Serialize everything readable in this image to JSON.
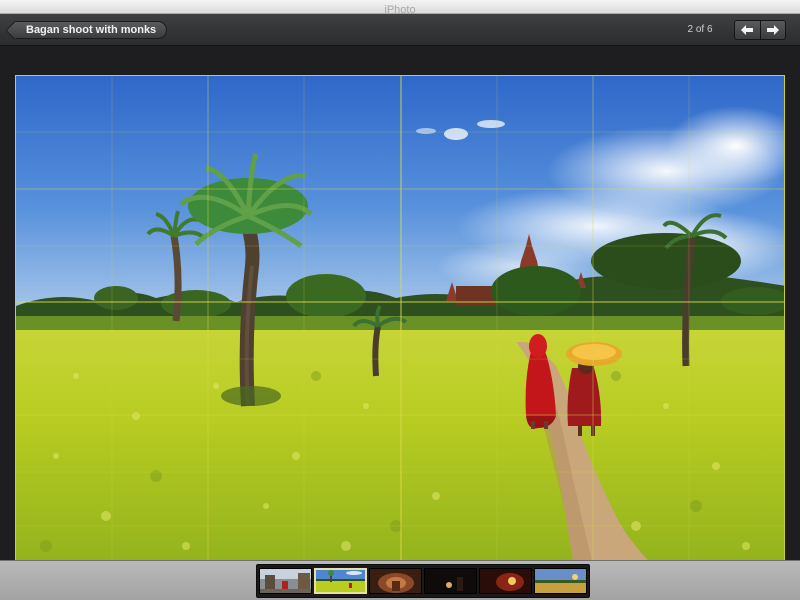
{
  "window": {
    "title": "iPhoto"
  },
  "toolbar": {
    "album_button_label": "Bagan shoot with monks",
    "page_counter": "2 of 6",
    "prev_icon": "left-arrow-icon",
    "next_icon": "right-arrow-icon"
  },
  "viewer": {
    "grid_color": "#d9d94a",
    "border_color": "#c9cf3a",
    "photo_index": 2,
    "photo_count": 6
  },
  "filmstrip": {
    "selected_index": 1,
    "thumbnails": [
      {
        "name": "thumb-street-scene"
      },
      {
        "name": "thumb-bagan-field"
      },
      {
        "name": "thumb-temple-interior"
      },
      {
        "name": "thumb-dark-scene"
      },
      {
        "name": "thumb-candle-light"
      },
      {
        "name": "thumb-landscape"
      }
    ]
  }
}
